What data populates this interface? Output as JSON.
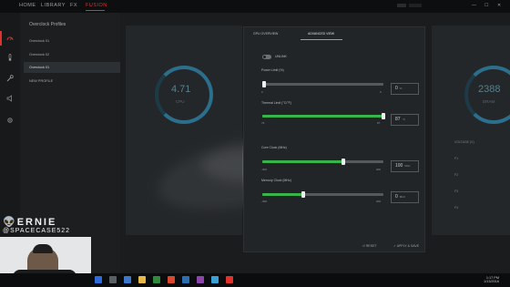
{
  "nav": {
    "home": "HOME",
    "library": "LIBRARY",
    "fx": "FX",
    "fusion": "FUSION",
    "active": "fusion"
  },
  "window_controls": {
    "minimize": "—",
    "maximize": "☐",
    "close": "✕"
  },
  "profiles": {
    "title": "Overclock Profiles",
    "items": [
      {
        "label": "Overclock 01",
        "selected": false
      },
      {
        "label": "Overclock 02",
        "selected": false
      },
      {
        "label": "Overclock 01",
        "selected": true
      },
      {
        "label": "NEW PROFILE",
        "selected": false
      }
    ]
  },
  "background": {
    "left_gauge_value": "4.71",
    "left_gauge_unit": "CPU",
    "right_gauge_value": "2388",
    "right_gauge_unit": "DRAM",
    "right_list": [
      "VOLTAGE (V)",
      "F1",
      "F2",
      "F3",
      "F4"
    ]
  },
  "panel": {
    "tabs": [
      {
        "label": "GPU OVERVIEW",
        "active": false
      },
      {
        "label": "ADVANCED VIEW",
        "active": true
      }
    ],
    "toggle_label": "UNLINK",
    "sliders": [
      {
        "label": "Power Limit (%)",
        "min": "0",
        "max": "0",
        "fraction": 0.0,
        "value": "0",
        "unit": "%",
        "active": false
      },
      {
        "label": "Thermal Limit (°C/°F)",
        "min": "76",
        "max": "87",
        "fraction": 1.0,
        "value": "87",
        "unit": "°C",
        "active": true
      },
      {
        "label": "Core Clock (MHz)",
        "min": "-300",
        "max": "200",
        "fraction": 0.67,
        "value": "100",
        "unit": "MHz",
        "active": true
      },
      {
        "label": "Memory Clock (MHz)",
        "min": "-300",
        "max": "200",
        "fraction": 0.34,
        "value": "0",
        "unit": "MHz",
        "active": true
      }
    ],
    "footer": {
      "reset": "RESET",
      "apply": "APPLY & SAVE"
    }
  },
  "overlay": {
    "name": "ERNIE",
    "handle": "@SPACECASE522"
  },
  "taskbar": {
    "time": "1:17 PM",
    "date": "1/13/2016"
  },
  "colors": {
    "accent": "#e0312b",
    "slider_fill": "#38b54a",
    "gauge": "#2b6f8c"
  }
}
